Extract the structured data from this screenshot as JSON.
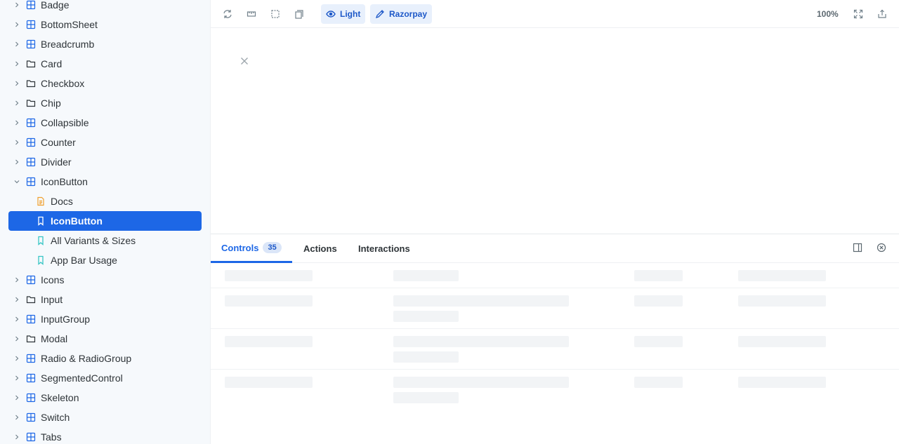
{
  "sidebar": {
    "items": [
      {
        "label": "Badge",
        "kind": "component",
        "expanded": false
      },
      {
        "label": "BottomSheet",
        "kind": "component",
        "expanded": false
      },
      {
        "label": "Breadcrumb",
        "kind": "component",
        "expanded": false
      },
      {
        "label": "Card",
        "kind": "folder",
        "expanded": false
      },
      {
        "label": "Checkbox",
        "kind": "folder",
        "expanded": false
      },
      {
        "label": "Chip",
        "kind": "folder",
        "expanded": false
      },
      {
        "label": "Collapsible",
        "kind": "component",
        "expanded": false
      },
      {
        "label": "Counter",
        "kind": "component",
        "expanded": false
      },
      {
        "label": "Divider",
        "kind": "component",
        "expanded": false
      },
      {
        "label": "IconButton",
        "kind": "component",
        "expanded": true
      },
      {
        "label": "Docs",
        "kind": "docs",
        "child": true
      },
      {
        "label": "IconButton",
        "kind": "story",
        "child": true,
        "selected": true
      },
      {
        "label": "All Variants & Sizes",
        "kind": "story",
        "child": true
      },
      {
        "label": "App Bar Usage",
        "kind": "story",
        "child": true
      },
      {
        "label": "Icons",
        "kind": "component",
        "expanded": false
      },
      {
        "label": "Input",
        "kind": "folder",
        "expanded": false
      },
      {
        "label": "InputGroup",
        "kind": "component",
        "expanded": false
      },
      {
        "label": "Modal",
        "kind": "folder",
        "expanded": false
      },
      {
        "label": "Radio & RadioGroup",
        "kind": "component",
        "expanded": false
      },
      {
        "label": "SegmentedControl",
        "kind": "component",
        "expanded": false
      },
      {
        "label": "Skeleton",
        "kind": "component",
        "expanded": false
      },
      {
        "label": "Switch",
        "kind": "component",
        "expanded": false
      },
      {
        "label": "Tabs",
        "kind": "component",
        "expanded": false
      }
    ]
  },
  "toolbar": {
    "icons": [
      "reload-icon",
      "ruler-icon",
      "outline-icon",
      "viewport-icon"
    ],
    "theme_label": "Light",
    "brand_label": "Razorpay",
    "zoom": "100%"
  },
  "panel": {
    "tabs": [
      {
        "label": "Controls",
        "count": "35"
      },
      {
        "label": "Actions"
      },
      {
        "label": "Interactions"
      }
    ]
  },
  "colors": {
    "accent": "#1d67e6",
    "sidebar_bg": "#f6f9fc",
    "skeleton": "#f2f4f6"
  }
}
